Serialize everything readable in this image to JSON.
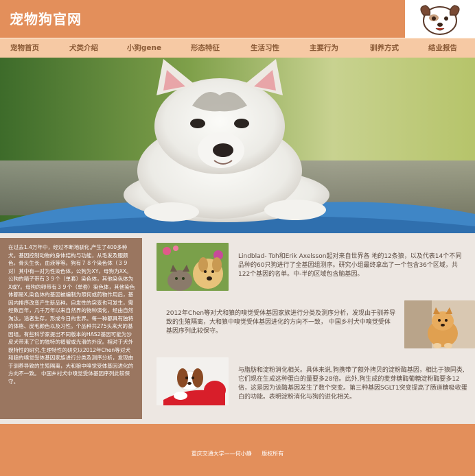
{
  "header": {
    "site_title": "宠物狗官网"
  },
  "nav": {
    "items": [
      {
        "label": "宠物首页"
      },
      {
        "label": "犬类介绍"
      },
      {
        "label": "小狗gene"
      },
      {
        "label": "形态特征"
      },
      {
        "label": "生活习性"
      },
      {
        "label": "主要行为"
      },
      {
        "label": "驯养方式"
      },
      {
        "label": "结业报告"
      }
    ]
  },
  "sidebar": {
    "text": "在过去1.4万年中，经过不断地驯化,产生了400多种犬。基因控制动物的身体结构与功能，从毛发及服颜色，骨头生长，血液等等。狗有７８个染色体（３９对）其中有一对为性染色体，公狗为XY，母狗为XX。公狗的精子带有３９个（单套）染色体，其他染色体为X或Y。母狗的卵带有３９个（单套）染色体，其他染色体都是X,染色体的基因被编制为照何或药物作用后，基因内排序改变产生新品种。自发性的突变也可发生，需经数百年，几千万年以来自然界的物种演化，经由自然淘汰，适者生存，形成今日的世界。每一种都具有独特的体格、皮毛颜色以及习性。个品种共275头来犬的基因组。有些科学家提出不同版本的HAS2基因可能为沙皮犬带来了它的独特的褶皱或光滑的外皮。相对于犬外貌特性的研究,生理特性的研究以2012年Chen等对犬和狼的嗅觉受体基因家族进行分类及测序分析，发现由于驯养导致的生殖隔离，大和狼中嗅觉受体基因进化的方向不一致。 中国乡村犬中嗅觉受体基因序列此较保守。"
  },
  "articles": [
    {
      "text": "Lindblad- Toh和Erik Axelsson起对来自世界各 地的12条狼，以及代表14个不同品种的60只狗进行了全基因组测序。研究小组最终拿出了一个包含36个区域，共 122个基因的名单。中-半的区域包含脑基因。"
    },
    {
      "text": "2012年Chen等对犬和狼的嗅觉受体基因家族进行分类及测序分析，发现由于驯养导致的生殖隔离，大和狼中嗅觉受体基因进化的方向不一致， 中国乡村犬中嗅觉受体基因序列此较保守。"
    },
    {
      "text": "与脂肪和淀粉消化相关。具体来说,狗携带了额外拷贝的淀粉酶基因，相比于狼同类,它们现在生成这种蛋白的量要多28倍。此外,狗生成的麦芽糖酶葡糖淀粉酶要多12倍，这是因为该酶基因发生了数个突变。第三种基因SGLT1突变提高了肠道糖吸收蛋白的功能。表明淀粉消化与狗的进化相关。"
    }
  ],
  "footer": {
    "author": "重庆交通大学——何小静",
    "rights": "版权所有"
  },
  "colors": {
    "header": "#e38f5b",
    "nav": "#f6c9a4",
    "sidebar": "#9a7660",
    "content_bg": "#ede7e2"
  }
}
